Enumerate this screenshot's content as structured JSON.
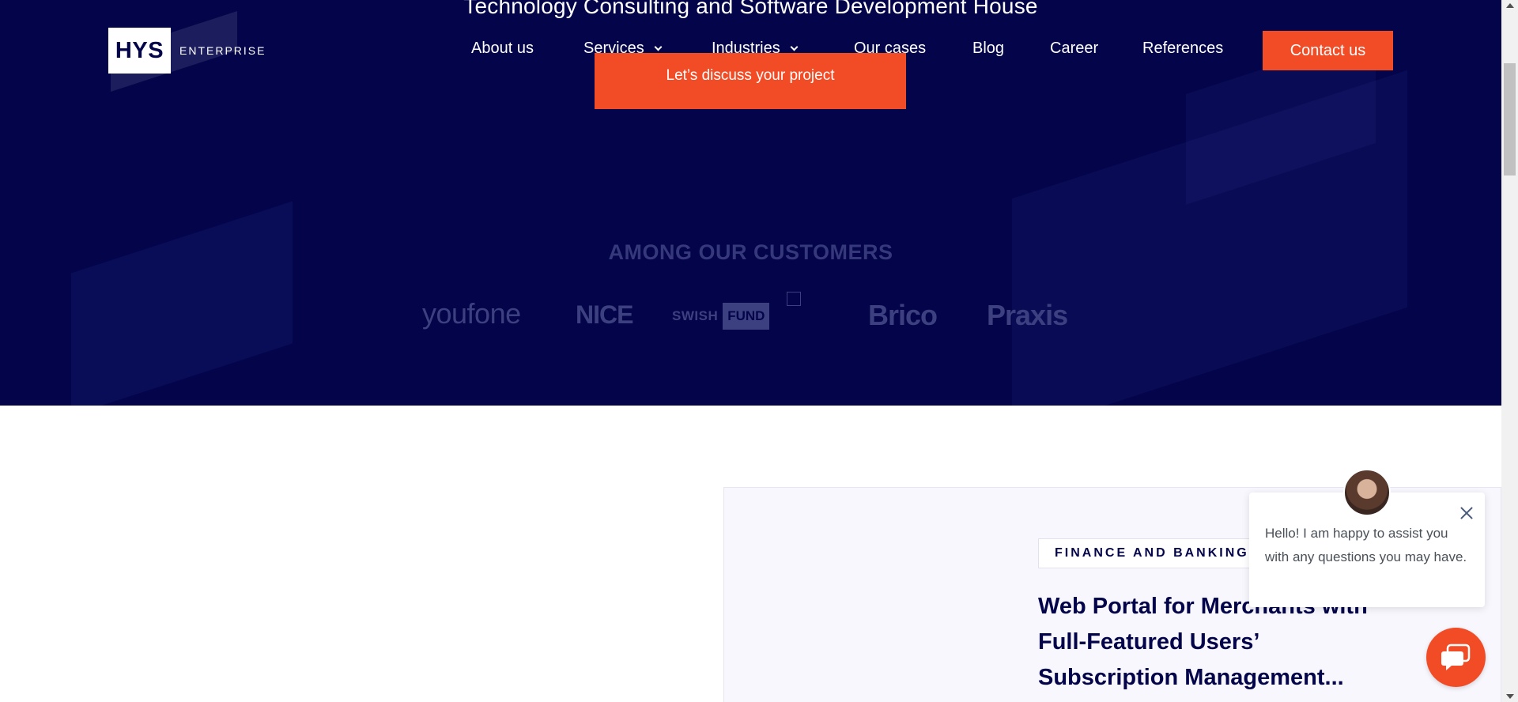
{
  "hero": {
    "title": "Technology Consulting and Software Development House",
    "cta_label": "Let’s discuss your project"
  },
  "header": {
    "logo_mark": "HYS",
    "logo_text": "ENTERPRISE",
    "nav": {
      "about": "About us",
      "services": "Services",
      "industries": "Industries",
      "cases": "Our cases",
      "blog": "Blog",
      "career": "Career",
      "references": "References"
    },
    "contact_label": "Contact us"
  },
  "customers": {
    "title": "AMONG OUR CUSTOMERS",
    "logos": {
      "youfone": "youfone",
      "nice": "NICE",
      "swish": "SWISH",
      "swish_fund": "FUND",
      "brico": "Brico",
      "praxis": "Praxis"
    }
  },
  "case": {
    "tag": "FINANCE AND BANKING",
    "title": "Web Portal for Merchants with Full-Featured Users’ Subscription Management..."
  },
  "chat": {
    "message": "Hello! I am happy to assist you with any questions you may have."
  },
  "colors": {
    "hero_bg": "#03044a",
    "accent": "#f24c27",
    "card_bg": "#f7f7fd"
  }
}
